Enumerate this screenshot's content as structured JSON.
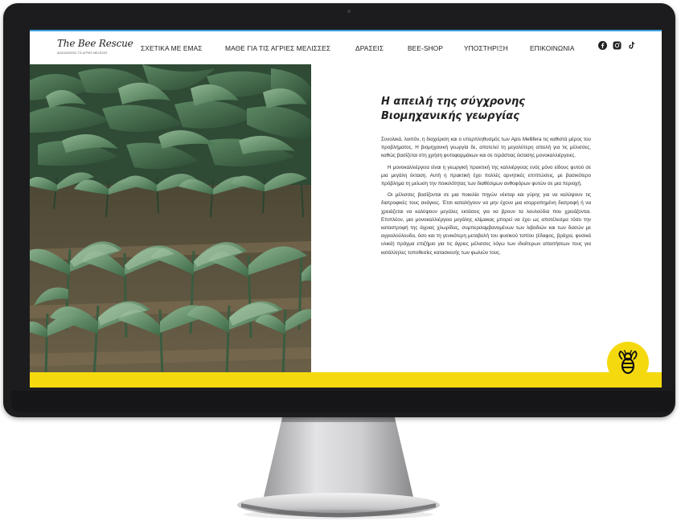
{
  "logo": {
    "title": "The Bee Rescue",
    "subtitle": "ΔΙΑΣΩΖΟΝΤΑΣ ΤΙΣ ΑΓΡΙΕΣ ΜΕΛΙΣΣΕΣ"
  },
  "nav": {
    "items": [
      {
        "label": "ΣΧΕΤΙΚΑ ΜΕ ΕΜΑΣ"
      },
      {
        "label": "ΜΑΘΕ ΓΙΑ ΤΙΣ ΑΓΡΙΕΣ ΜΕΛΙΣΣΕΣ"
      },
      {
        "label": "ΔΡΑΣΕΙΣ"
      },
      {
        "label": "BEE-SHOP"
      },
      {
        "label": "ΥΠΟΣΤΗΡΙΞΗ"
      },
      {
        "label": "ΕΠΙΚΟΙΝΩΝΙΑ"
      }
    ],
    "social_icons": [
      "facebook-icon",
      "instagram-icon",
      "tiktok-icon"
    ]
  },
  "article": {
    "title_line1": "Η απειλή της σύγχρονης",
    "title_line2": "Βιομηχανικής γεωργίας",
    "paragraphs": [
      "Συνολικά, λοιπόν, η διαχείριση και ο υπερπληθυσμός των Apis Mellifera τις καθιστά μέρος του προβλήματος. Η βιομηχανική γεωργία δε, αποτελεί τη μεγαλύτερη απειλή για τις μέλισσες, καθώς βασίζεται στη χρήση φυτοφαρμάκων και σε τεράστιας έκτασης μονοκαλλιέργειες.",
      "Η μονοκαλλιέργεια είναι η γεωργική πρακτική της καλλιέργειας ενός μόνο είδους φυτού σε μια μεγάλη έκταση. Αυτή η πρακτική έχει πολλές αρνητικές επιπτώσεις, με βασικότερο πρόβλημα τη μείωση την ποικιλότητας των διαθέσιμων ανθοφόρων φυτών σε μια περιοχή.",
      "Οι μέλισσες βασίζονται σε μια ποικιλία πηγών νέκταρ και γύρης για να καλύψουν τις διατροφικές τους ανάγκες. Έτσι καταλήγουν να μην έχουν μια ισορροπημένη διατροφή ή να χρειάζεται να καλύψουν μεγάλες εκτάσεις για να βρουν τα λουλούδια που χρειάζονται. Επιπλέον, μια μονοκαλλιέργεια μεγάλης κλίμακας μπορεί να έχει ως αποτέλεσμα τόσο την καταστροφή της άγριας χλωρίδας, συμπεριλαμβανομένων των λιβαδιών και των δασών με αγριολούλουδα, όσο και τη γενικότερη μεταβολή του φυσικού τοπίου (έδαφος, βράχια, φυσικά υλικά) πράγμα επιζήμιο για τις άγριες μέλισσες λόγω των ιδιαίτερων απαιτήσεων τους για κατάλληλες τοποθεσίες κατασκευής των φωλιών τους."
    ]
  },
  "colors": {
    "accent_yellow": "#f5d90f",
    "nav_top_border": "#3a9de0",
    "bezel": "#1c1c1e",
    "text": "#222222"
  }
}
